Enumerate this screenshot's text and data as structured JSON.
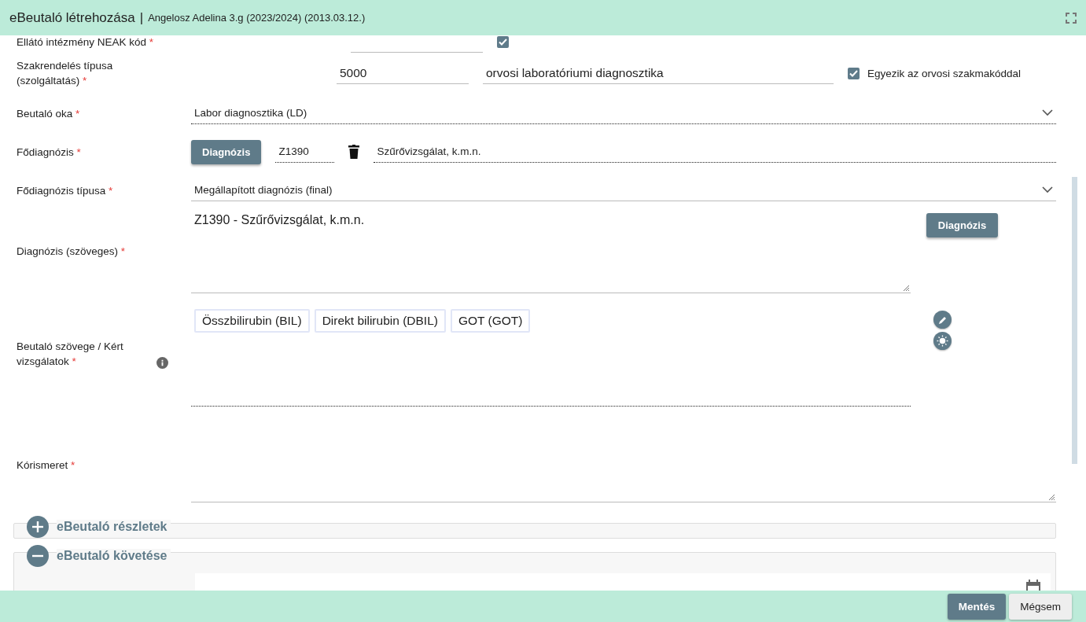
{
  "dialog": {
    "title": "eBeutaló létrehozása",
    "separator": "|",
    "subtitle": "Angelosz Adelina 3.g (2023/2024) (2013.03.12.)"
  },
  "neak": {
    "label": "Ellátó intézmény NEAK kód",
    "required": "*",
    "checked": true
  },
  "service_type": {
    "label": "Szakrendelés típusa (szolgáltatás)",
    "required": "*",
    "code": "5000",
    "name": "orvosi laboratóriumi diagnosztika",
    "match": {
      "label": "Egyezik az orvosi szakmakóddal",
      "checked": true
    }
  },
  "reason": {
    "label": "Beutaló oka",
    "required": "*",
    "value": "Labor diagnosztika (LD)"
  },
  "main_diagnosis": {
    "label": "Fődiagnózis",
    "required": "*",
    "button": "Diagnózis",
    "code": "Z1390",
    "name": "Szűrővizsgálat, k.m.n."
  },
  "diagnosis_type": {
    "label": "Fődiagnózis típusa",
    "required": "*",
    "value": "Megállapított diagnózis (final)"
  },
  "diagnosis_text": {
    "label": "Diagnózis (szöveges)",
    "required": "*",
    "value": "Z1390 - Szűrővizsgálat, k.m.n.",
    "button": "Diagnózis"
  },
  "referral_text": {
    "label": "Beutaló szövege / Kért vizsgálatok",
    "required": "*",
    "chips": [
      "Összbilirubin (BIL)",
      "Direkt bilirubin (DBIL)",
      "GOT (GOT)"
    ]
  },
  "findings": {
    "label": "Kórismeret",
    "required": "*"
  },
  "sections": [
    {
      "title": "eBeutaló részletek",
      "expanded": false
    },
    {
      "title": "eBeutaló követése",
      "expanded": true
    }
  ],
  "footer": {
    "buttons": [
      {
        "label": "Mentés",
        "kind": "primary"
      },
      {
        "label": "Mégsem",
        "kind": "secondary"
      }
    ]
  }
}
